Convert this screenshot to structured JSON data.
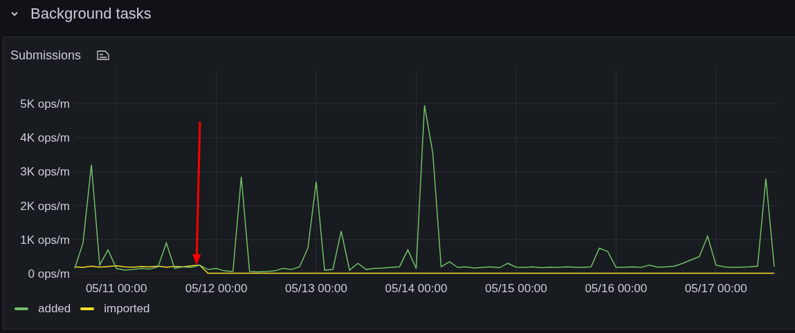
{
  "section": {
    "title": "Background tasks",
    "expanded": true
  },
  "panel": {
    "title": "Submissions",
    "has_description": true,
    "marker_arrow": {
      "color": "#ff0000"
    },
    "chart_data": {
      "type": "line",
      "grid": true,
      "ylim": [
        0,
        5000
      ],
      "categories": [
        null,
        null,
        null,
        null,
        null,
        "05/11 00:00",
        null,
        null,
        null,
        null,
        null,
        null,
        null,
        null,
        null,
        null,
        null,
        "05/12 00:00",
        null,
        null,
        null,
        null,
        null,
        null,
        null,
        null,
        null,
        null,
        null,
        "05/13 00:00",
        null,
        null,
        null,
        null,
        null,
        null,
        null,
        null,
        null,
        null,
        null,
        "05/14 00:00",
        null,
        null,
        null,
        null,
        null,
        null,
        null,
        null,
        null,
        null,
        null,
        "05/15 00:00",
        null,
        null,
        null,
        null,
        null,
        null,
        null,
        null,
        null,
        null,
        null,
        "05/16 00:00",
        null,
        null,
        null,
        null,
        null,
        null,
        null,
        null,
        null,
        null,
        null,
        "05/17 00:00",
        null,
        null,
        null,
        null,
        null,
        null,
        null
      ],
      "yticks": [
        {
          "value": 0,
          "label": "0 ops/m"
        },
        {
          "value": 1000,
          "label": "1K ops/m"
        },
        {
          "value": 2000,
          "label": "2K ops/m"
        },
        {
          "value": 3000,
          "label": "3K ops/m"
        },
        {
          "value": 4000,
          "label": "4K ops/m"
        },
        {
          "value": 5000,
          "label": "5K ops/m"
        }
      ],
      "series": [
        {
          "name": "added",
          "color": "#73bf69",
          "values": [
            150,
            900,
            3200,
            250,
            700,
            150,
            100,
            120,
            150,
            130,
            200,
            900,
            150,
            200,
            180,
            250,
            120,
            150,
            80,
            60,
            2850,
            60,
            50,
            60,
            80,
            150,
            120,
            200,
            750,
            2700,
            100,
            120,
            1250,
            100,
            300,
            120,
            150,
            160,
            180,
            200,
            700,
            150,
            4950,
            3550,
            200,
            350,
            180,
            200,
            160,
            180,
            200,
            170,
            300,
            190,
            180,
            200,
            170,
            190,
            180,
            200,
            190,
            180,
            200,
            750,
            650,
            180,
            190,
            200,
            180,
            250,
            190,
            200,
            220,
            300,
            400,
            500,
            1100,
            250,
            200,
            180,
            190,
            200,
            220,
            2800,
            200
          ]
        },
        {
          "name": "imported",
          "color": "#fade2a",
          "values": [
            200,
            180,
            220,
            190,
            210,
            230,
            200,
            190,
            210,
            200,
            220,
            190,
            210,
            200,
            230,
            250,
            10,
            10,
            10,
            10,
            10,
            10,
            10,
            10,
            10,
            10,
            10,
            10,
            10,
            10,
            10,
            10,
            10,
            10,
            10,
            10,
            10,
            10,
            10,
            10,
            10,
            10,
            10,
            10,
            10,
            10,
            10,
            10,
            10,
            10,
            10,
            10,
            10,
            10,
            10,
            10,
            10,
            10,
            10,
            10,
            10,
            10,
            10,
            10,
            10,
            10,
            10,
            10,
            10,
            10,
            10,
            10,
            10,
            10,
            10,
            10,
            10,
            10,
            10,
            10,
            10,
            10,
            10,
            10,
            10
          ]
        }
      ]
    }
  }
}
